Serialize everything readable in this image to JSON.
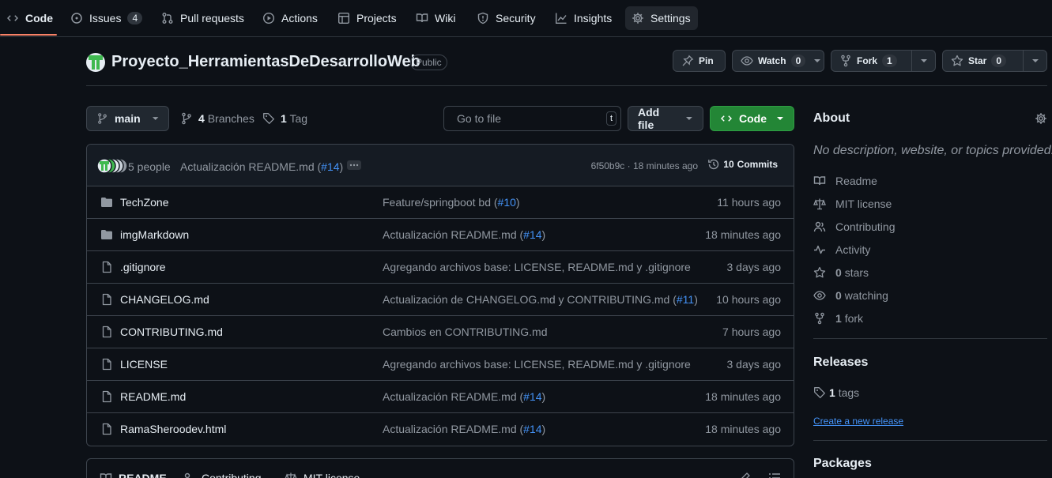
{
  "tabs": {
    "code": "Code",
    "issues": "Issues",
    "issues_count": "4",
    "pull_requests": "Pull requests",
    "actions": "Actions",
    "projects": "Projects",
    "wiki": "Wiki",
    "security": "Security",
    "insights": "Insights",
    "settings": "Settings"
  },
  "repo": {
    "name": "Proyecto_HerramientasDeDesarrolloWeb",
    "visibility": "Public",
    "pin_label": "Pin",
    "watch_label": "Watch",
    "watch_count": "0",
    "fork_label": "Fork",
    "fork_count": "1",
    "star_label": "Star",
    "star_count": "0"
  },
  "toolbar": {
    "branch": "main",
    "branches_count": "4",
    "branches_label": "Branches",
    "tags_count": "1",
    "tags_label": "Tag",
    "goto_placeholder": "Go to file",
    "goto_shortcut": "t",
    "add_file": "Add file",
    "code_button": "Code"
  },
  "latest_commit": {
    "people": "5 people",
    "message": "Actualización README.md (",
    "pr": "#14",
    "close": ")",
    "hash_time": "6f50b9c · 18 minutes ago",
    "commits_count": "10",
    "commits_label": "Commits"
  },
  "files": [
    {
      "name": "TechZone",
      "type": "folder",
      "message": "Feature/springboot bd (",
      "pr": "#10",
      "close": ")",
      "date": "11 hours ago"
    },
    {
      "name": "imgMarkdown",
      "type": "folder",
      "message": "Actualización README.md (",
      "pr": "#14",
      "close": ")",
      "date": "18 minutes ago"
    },
    {
      "name": ".gitignore",
      "type": "file",
      "message": "Agregando archivos base: LICENSE, README.md y .gitignore",
      "pr": "",
      "close": "",
      "date": "3 days ago"
    },
    {
      "name": "CHANGELOG.md",
      "type": "file",
      "message": "Actualización de CHANGELOG.md y CONTRIBUTING.md (",
      "pr": "#11",
      "close": ")",
      "date": "10 hours ago"
    },
    {
      "name": "CONTRIBUTING.md",
      "type": "file",
      "message": "Cambios en CONTRIBUTING.md",
      "pr": "",
      "close": "",
      "date": "7 hours ago"
    },
    {
      "name": "LICENSE",
      "type": "file",
      "message": "Agregando archivos base: LICENSE, README.md y .gitignore",
      "pr": "",
      "close": "",
      "date": "3 days ago"
    },
    {
      "name": "README.md",
      "type": "file",
      "message": "Actualización README.md (",
      "pr": "#14",
      "close": ")",
      "date": "18 minutes ago"
    },
    {
      "name": "RamaSheroodev.html",
      "type": "file",
      "message": "Actualización README.md (",
      "pr": "#14",
      "close": ")",
      "date": "18 minutes ago"
    }
  ],
  "readme_tabs": {
    "readme": "README",
    "contributing": "Contributing",
    "license": "MIT license"
  },
  "sidebar": {
    "about_title": "About",
    "description": "No description, website, or topics provided.",
    "items": [
      {
        "label": "Readme",
        "icon": "book-icon"
      },
      {
        "label": "MIT license",
        "icon": "law-icon"
      },
      {
        "label": "Contributing",
        "icon": "people-icon"
      },
      {
        "label": "Activity",
        "icon": "pulse-icon"
      }
    ],
    "stars_count": "0",
    "stars_label": "stars",
    "watching_count": "0",
    "watching_label": "watching",
    "fork_count": "1",
    "fork_label": "fork",
    "releases_title": "Releases",
    "tags_count": "1",
    "tags_label": "tags",
    "create_release": "Create a new release",
    "packages_title": "Packages"
  },
  "colors": {
    "background": "#0d1117",
    "border": "#3d444d",
    "accent_link": "#4493f8",
    "code_button": "#238636",
    "tab_underline": "#f78166"
  }
}
